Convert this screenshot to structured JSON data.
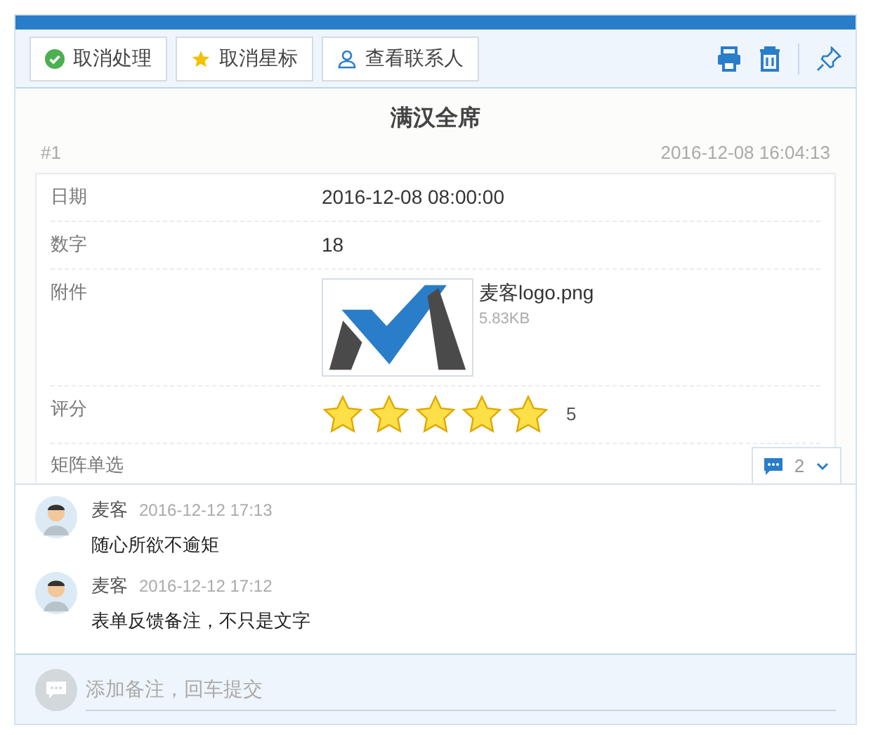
{
  "toolbar": {
    "buttons": [
      {
        "kind": "check",
        "label": "取消处理"
      },
      {
        "kind": "star",
        "label": "取消星标"
      },
      {
        "kind": "user",
        "label": "查看联系人"
      }
    ]
  },
  "record": {
    "title": "满汉全席",
    "number": "#1",
    "time": "2016-12-08 16:04:13",
    "fields": [
      {
        "kind": "text",
        "label": "日期",
        "value": "2016-12-08 08:00:00"
      },
      {
        "kind": "text",
        "label": "数字",
        "value": "18"
      },
      {
        "kind": "file",
        "label": "附件",
        "file_name": "麦客logo.png",
        "file_size": "5.83KB"
      },
      {
        "kind": "rating",
        "label": "评分",
        "stars": 5,
        "value": "5"
      },
      {
        "kind": "partial",
        "label": "矩阵单选"
      }
    ]
  },
  "comments_toggle": {
    "count": "2"
  },
  "comments": [
    {
      "author": "麦客",
      "time": "2016-12-12 17:13",
      "text": "随心所欲不逾矩"
    },
    {
      "author": "麦客",
      "time": "2016-12-12 17:12",
      "text": "表单反馈备注，不只是文字"
    }
  ],
  "comment_input": {
    "placeholder": "添加备注，回车提交"
  }
}
